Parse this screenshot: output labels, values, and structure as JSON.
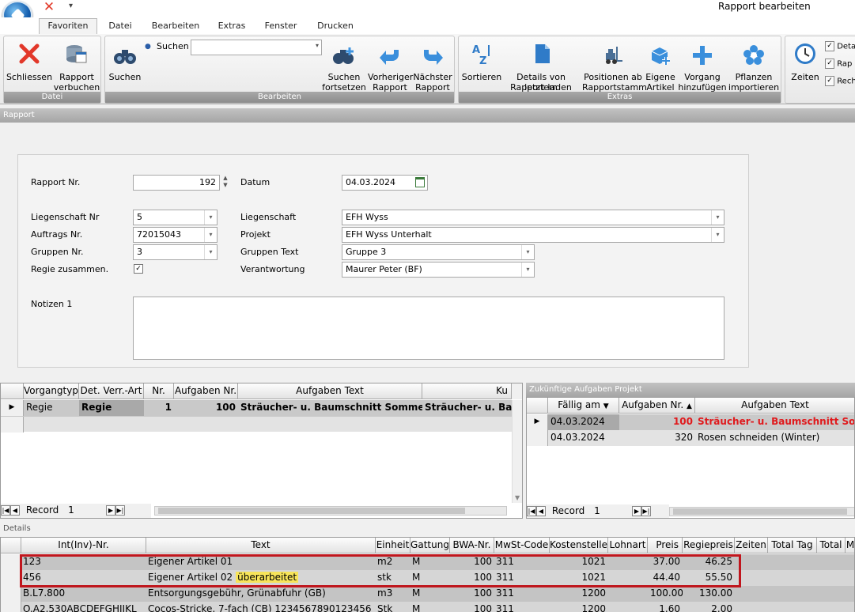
{
  "window": {
    "title": "Rapport bearbeiten"
  },
  "tabs": [
    "Favoriten",
    "Datei",
    "Bearbeiten",
    "Extras",
    "Fenster",
    "Drucken"
  ],
  "ribbon": {
    "groups": {
      "datei": "Datei",
      "bearbeiten": "Bearbeiten",
      "extras": "Extras"
    },
    "buttons": {
      "schliessen": "Schliessen",
      "rapport_verbuchen_1": "Rapport",
      "rapport_verbuchen_2": "verbuchen",
      "suchen": "Suchen",
      "suchen_label": "Suchen",
      "suchen_fort_1": "Suchen",
      "suchen_fort_2": "fortsetzen",
      "vorheriger_1": "Vorheriger",
      "vorheriger_2": "Rapport",
      "naechster_1": "Nächster",
      "naechster_2": "Rapport",
      "sortieren": "Sortieren",
      "details_1": "Details von letztem",
      "details_2": "Rapport laden",
      "positionen_1": "Positionen ab",
      "positionen_2": "Rapportstamm",
      "eigene_1": "Eigene",
      "eigene_2": "Artikel",
      "vorgang_1": "Vorgang",
      "vorgang_2": "hinzufügen",
      "pflanzen_1": "Pflanzen",
      "pflanzen_2": "importieren",
      "zeiten": "Zeiten"
    },
    "checks": [
      "Deta",
      "Rap",
      "Rech"
    ]
  },
  "sections": {
    "rapport": "Rapport",
    "zukuenftige": "Zukünftige Aufgaben Projekt",
    "details": "Details"
  },
  "form": {
    "rapport_nr_label": "Rapport Nr.",
    "rapport_nr": "192",
    "datum_label": "Datum",
    "datum": "04.03.2024",
    "liegenschaft_nr_label": "Liegenschaft Nr",
    "liegenschaft_nr": "5",
    "auftrags_nr_label": "Auftrags Nr.",
    "auftrags_nr": "72015043",
    "gruppen_nr_label": "Gruppen Nr.",
    "gruppen_nr": "3",
    "regie_label": "Regie zusammen.",
    "liegenschaft_label": "Liegenschaft",
    "liegenschaft": "EFH Wyss",
    "projekt_label": "Projekt",
    "projekt": "EFH Wyss Unterhalt",
    "gruppen_text_label": "Gruppen Text",
    "gruppen_text": "Gruppe 3",
    "verantwortung_label": "Verantwortung",
    "verantwortung": "Maurer Peter (BF)",
    "notizen_label": "Notizen 1"
  },
  "vorgang_grid": {
    "headers": [
      "Vorgangtyp",
      "Det. Verr.-Art",
      "Nr.",
      "Aufgaben Nr.",
      "Aufgaben Text",
      "Ku"
    ],
    "row": {
      "typ": "Regie",
      "art": "Regie",
      "nr": "1",
      "aufg_nr": "100",
      "text": "Sträucher- u. Baumschnitt Sommer",
      "ku": "Sträucher- u. Ba"
    },
    "record_label": "Record",
    "record_value": "1"
  },
  "zukunft_grid": {
    "headers": [
      "Fällig am",
      "Aufgaben Nr.",
      "Aufgaben Text"
    ],
    "rows": [
      {
        "datum": "04.03.2024",
        "nr": "100",
        "text": "Sträucher- u. Baumschnitt Som"
      },
      {
        "datum": "04.03.2024",
        "nr": "320",
        "text": "Rosen schneiden (Winter)"
      }
    ],
    "record_label": "Record",
    "record_value": "1"
  },
  "details_grid": {
    "headers": [
      "Int(Inv)-Nr.",
      "Text",
      "Einheit",
      "Gattung",
      "BWA-Nr.",
      "MwSt-Code",
      "Kostenstelle",
      "Lohnart",
      "Preis",
      "Regiepreis",
      "Zeiten",
      "Total Tag",
      "Total",
      "M"
    ],
    "rows": [
      {
        "inv": "123",
        "text": "Eigener Artikel 01",
        "text_hl": "",
        "einheit": "m2",
        "gattung": "M",
        "bwa": "100",
        "mwst": "311",
        "kst": "1021",
        "lohnart": "",
        "preis": "37.00",
        "regie": "46.25"
      },
      {
        "inv": "456",
        "text": "Eigener Artikel 02",
        "text_hl": "überarbeitet",
        "einheit": "stk",
        "gattung": "M",
        "bwa": "100",
        "mwst": "311",
        "kst": "1021",
        "lohnart": "",
        "preis": "44.40",
        "regie": "55.50"
      },
      {
        "inv": "B.L7.800",
        "text": "Entsorgungsgebühr, Grünabfuhr (GB)",
        "text_hl": "",
        "einheit": "m3",
        "gattung": "M",
        "bwa": "100",
        "mwst": "311",
        "kst": "1200",
        "lohnart": "",
        "preis": "100.00",
        "regie": "130.00"
      },
      {
        "inv": "O.A2.530ABCDEFGHIJKL",
        "text": "Cocos-Stricke, 7-fach (CB) 1234567890123456",
        "text_hl": "",
        "einheit": "Stk",
        "gattung": "M",
        "bwa": "100",
        "mwst": "311",
        "kst": "1200",
        "lohnart": "",
        "preis": "1.60",
        "regie": "2.00"
      }
    ]
  },
  "colors": {
    "highlight_box": "#c0161d",
    "highlight_text": "#f7e45a",
    "red_text": "#e0191c"
  }
}
